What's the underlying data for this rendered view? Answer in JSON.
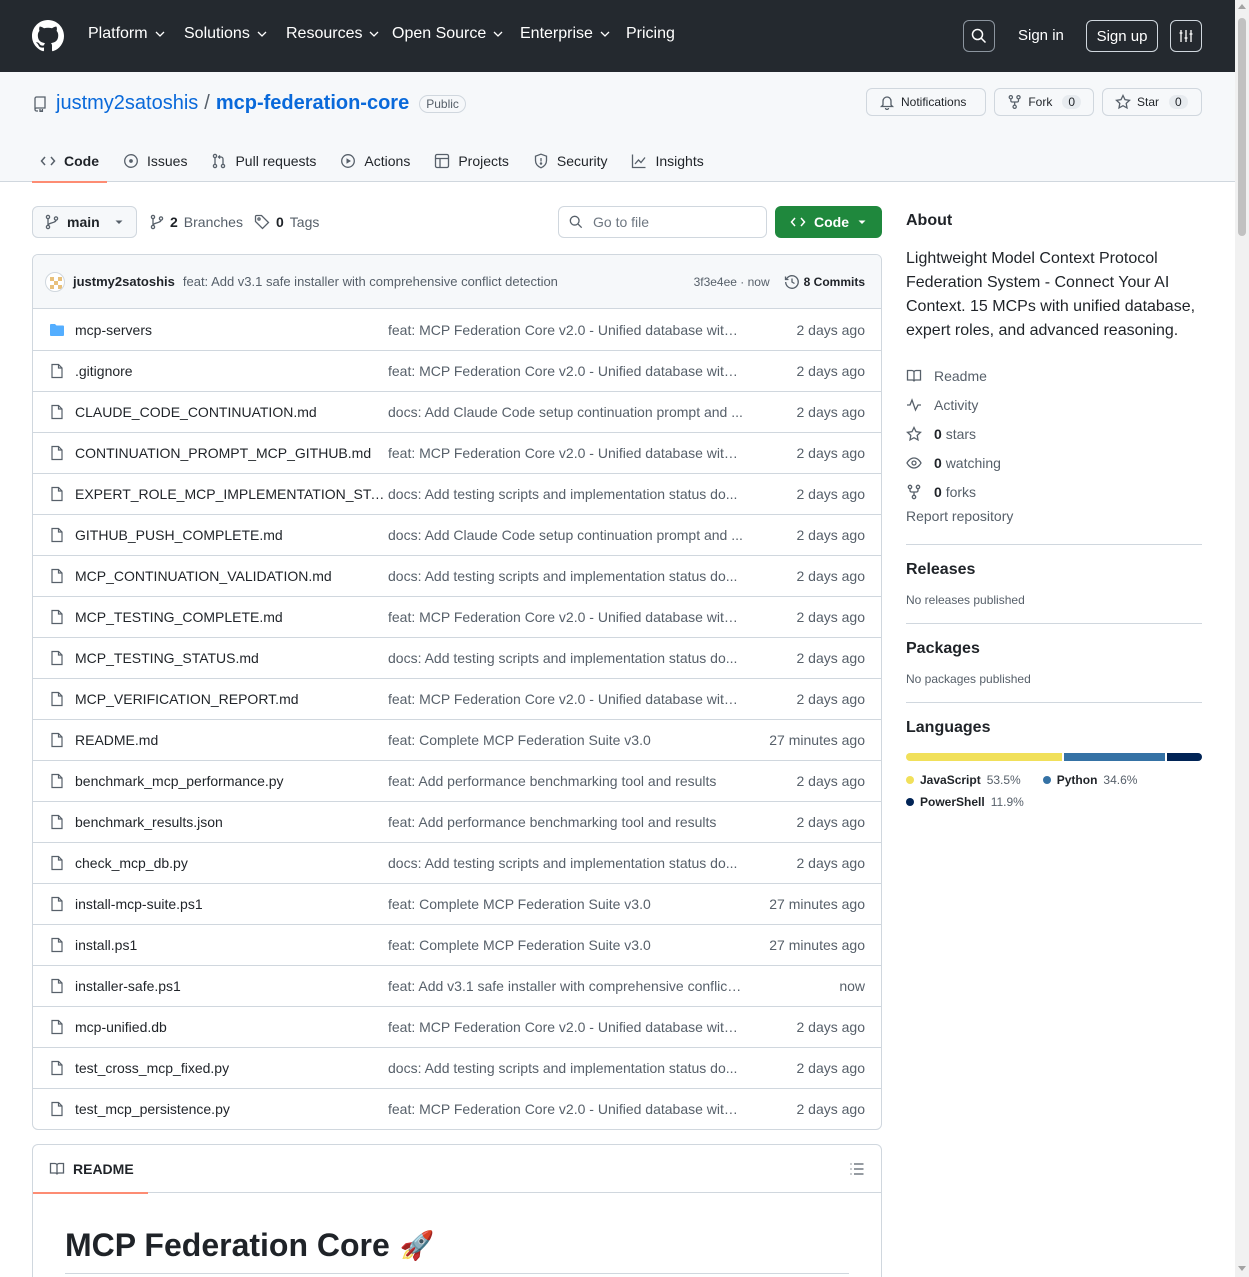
{
  "header": {
    "nav": [
      {
        "label": "Platform",
        "dropdown": true
      },
      {
        "label": "Solutions",
        "dropdown": true
      },
      {
        "label": "Resources",
        "dropdown": true
      },
      {
        "label": "Open Source",
        "dropdown": true
      },
      {
        "label": "Enterprise",
        "dropdown": true
      },
      {
        "label": "Pricing",
        "dropdown": false
      }
    ],
    "sign_in": "Sign in",
    "sign_up": "Sign up"
  },
  "repo": {
    "owner": "justmy2satoshis",
    "separator": "/",
    "name": "mcp-federation-core",
    "visibility": "Public",
    "notifications_label": "Notifications",
    "fork_label": "Fork",
    "fork_count": "0",
    "star_label": "Star",
    "star_count": "0"
  },
  "tabs": [
    {
      "label": "Code",
      "icon": "code-icon",
      "active": true
    },
    {
      "label": "Issues",
      "icon": "issue-icon",
      "active": false
    },
    {
      "label": "Pull requests",
      "icon": "pull-request-icon",
      "active": false
    },
    {
      "label": "Actions",
      "icon": "play-icon",
      "active": false
    },
    {
      "label": "Projects",
      "icon": "table-icon",
      "active": false
    },
    {
      "label": "Security",
      "icon": "shield-icon",
      "active": false
    },
    {
      "label": "Insights",
      "icon": "graph-icon",
      "active": false
    }
  ],
  "toolbar": {
    "branch": "main",
    "branches_count": "2",
    "branches_label": "Branches",
    "tags_count": "0",
    "tags_label": "Tags",
    "goto_placeholder": "Go to file",
    "code_button": "Code"
  },
  "latest_commit": {
    "author": "justmy2satoshis",
    "message": "feat: Add v3.1 safe installer with comprehensive conflict detection",
    "sha_time": "3f3e4ee · now",
    "commits_label": "8 Commits"
  },
  "files": [
    {
      "type": "folder",
      "name": "mcp-servers",
      "message": "feat: MCP Federation Core v2.0 - Unified database with ...",
      "date": "2 days ago"
    },
    {
      "type": "file",
      "name": ".gitignore",
      "message": "feat: MCP Federation Core v2.0 - Unified database with ...",
      "date": "2 days ago"
    },
    {
      "type": "file",
      "name": "CLAUDE_CODE_CONTINUATION.md",
      "message": "docs: Add Claude Code setup continuation prompt and ...",
      "date": "2 days ago"
    },
    {
      "type": "file",
      "name": "CONTINUATION_PROMPT_MCP_GITHUB.md",
      "message": "feat: MCP Federation Core v2.0 - Unified database with ...",
      "date": "2 days ago"
    },
    {
      "type": "file",
      "name": "EXPERT_ROLE_MCP_IMPLEMENTATION_STA...",
      "message": "docs: Add testing scripts and implementation status do...",
      "date": "2 days ago"
    },
    {
      "type": "file",
      "name": "GITHUB_PUSH_COMPLETE.md",
      "message": "docs: Add Claude Code setup continuation prompt and ...",
      "date": "2 days ago"
    },
    {
      "type": "file",
      "name": "MCP_CONTINUATION_VALIDATION.md",
      "message": "docs: Add testing scripts and implementation status do...",
      "date": "2 days ago"
    },
    {
      "type": "file",
      "name": "MCP_TESTING_COMPLETE.md",
      "message": "feat: MCP Federation Core v2.0 - Unified database with ...",
      "date": "2 days ago"
    },
    {
      "type": "file",
      "name": "MCP_TESTING_STATUS.md",
      "message": "docs: Add testing scripts and implementation status do...",
      "date": "2 days ago"
    },
    {
      "type": "file",
      "name": "MCP_VERIFICATION_REPORT.md",
      "message": "feat: MCP Federation Core v2.0 - Unified database with ...",
      "date": "2 days ago"
    },
    {
      "type": "file",
      "name": "README.md",
      "message": "feat: Complete MCP Federation Suite v3.0",
      "date": "27 minutes ago"
    },
    {
      "type": "file",
      "name": "benchmark_mcp_performance.py",
      "message": "feat: Add performance benchmarking tool and results",
      "date": "2 days ago"
    },
    {
      "type": "file",
      "name": "benchmark_results.json",
      "message": "feat: Add performance benchmarking tool and results",
      "date": "2 days ago"
    },
    {
      "type": "file",
      "name": "check_mcp_db.py",
      "message": "docs: Add testing scripts and implementation status do...",
      "date": "2 days ago"
    },
    {
      "type": "file",
      "name": "install-mcp-suite.ps1",
      "message": "feat: Complete MCP Federation Suite v3.0",
      "date": "27 minutes ago"
    },
    {
      "type": "file",
      "name": "install.ps1",
      "message": "feat: Complete MCP Federation Suite v3.0",
      "date": "27 minutes ago"
    },
    {
      "type": "file",
      "name": "installer-safe.ps1",
      "message": "feat: Add v3.1 safe installer with comprehensive conflict ...",
      "date": "now"
    },
    {
      "type": "file",
      "name": "mcp-unified.db",
      "message": "feat: MCP Federation Core v2.0 - Unified database with ...",
      "date": "2 days ago"
    },
    {
      "type": "file",
      "name": "test_cross_mcp_fixed.py",
      "message": "docs: Add testing scripts and implementation status do...",
      "date": "2 days ago"
    },
    {
      "type": "file",
      "name": "test_mcp_persistence.py",
      "message": "feat: MCP Federation Core v2.0 - Unified database with ...",
      "date": "2 days ago"
    }
  ],
  "readme": {
    "tab_label": "README",
    "title": "MCP Federation Core",
    "emoji": "🚀"
  },
  "about": {
    "heading": "About",
    "description": "Lightweight Model Context Protocol Federation System - Connect Your AI Context. 15 MCPs with unified database, expert roles, and advanced reasoning.",
    "readme": "Readme",
    "activity": "Activity",
    "stars_count": "0",
    "stars_label": "stars",
    "watching_count": "0",
    "watching_label": "watching",
    "forks_count": "0",
    "forks_label": "forks",
    "report": "Report repository"
  },
  "releases": {
    "heading": "Releases",
    "empty": "No releases published"
  },
  "packages": {
    "heading": "Packages",
    "empty": "No packages published"
  },
  "languages": {
    "heading": "Languages",
    "items": [
      {
        "name": "JavaScript",
        "percent": "53.5%",
        "value": 53.5,
        "color": "#f1e05a"
      },
      {
        "name": "Python",
        "percent": "34.6%",
        "value": 34.6,
        "color": "#3572A5"
      },
      {
        "name": "PowerShell",
        "percent": "11.9%",
        "value": 11.9,
        "color": "#012456"
      }
    ]
  }
}
